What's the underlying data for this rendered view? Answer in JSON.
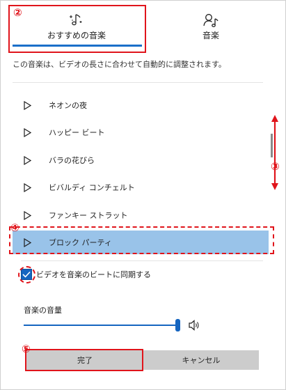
{
  "tabs": [
    {
      "label": "おすすめの音楽",
      "icon": "sparkle-music-icon"
    },
    {
      "label": "音楽",
      "icon": "person-music-icon"
    }
  ],
  "description": "この音楽は、ビデオの長さに合わせて自動的に調整されます。",
  "tracks": [
    {
      "title": "ネオンの夜"
    },
    {
      "title": "ハッピー ビート"
    },
    {
      "title": "バラの花びら"
    },
    {
      "title": "ビバルディ コンチェルト"
    },
    {
      "title": "ファンキー ストラット"
    },
    {
      "title": "ブロック パーティ",
      "selected": true
    }
  ],
  "sync_checkbox": {
    "label": "ビデオを音楽のビートに同期する",
    "checked": true
  },
  "volume": {
    "label": "音楽の音量",
    "level": 1.0
  },
  "buttons": {
    "done": "完了",
    "cancel": "キャンセル"
  },
  "annotations": {
    "n2": "②",
    "n3": "③",
    "n4": "④",
    "n5": "⑤"
  },
  "colors": {
    "accent": "#1565c0",
    "selected_row": "#99c3e9",
    "annotation": "#e0141b",
    "button": "#cccccc"
  }
}
